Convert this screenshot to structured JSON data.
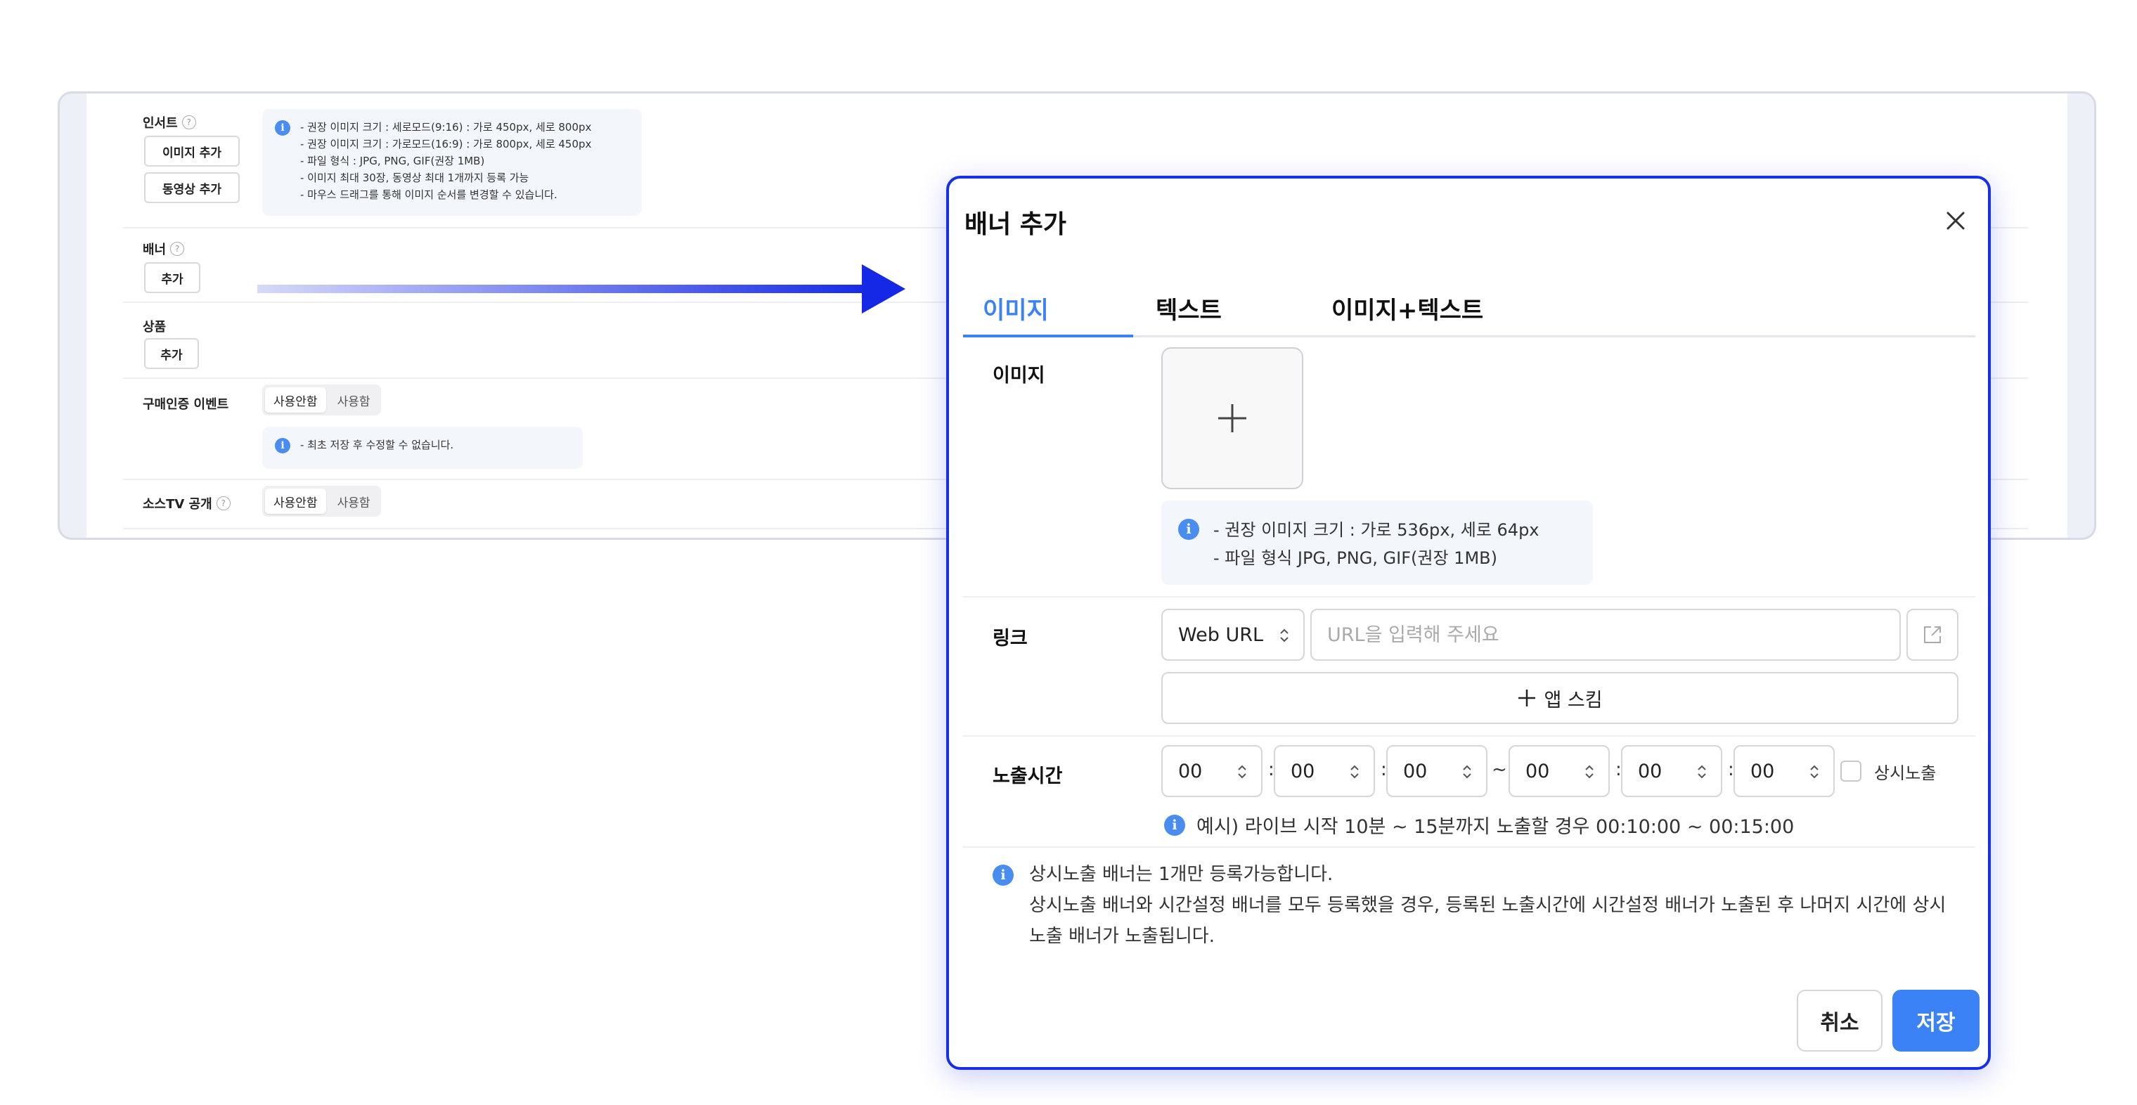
{
  "background_form": {
    "insert": {
      "label": "인서트",
      "add_image_button": "이미지 추가",
      "add_video_button": "동영상 추가",
      "info_lines": [
        "- 권장 이미지 크기 : 세로모드(9:16) : 가로 450px, 세로 800px",
        "- 권장 이미지 크기 : 가로모드(16:9) : 가로 800px, 세로 450px",
        "- 파일 형식 : JPG, PNG, GIF(권장 1MB)",
        "- 이미지 최대 30장, 동영상 최대 1개까지 등록 가능",
        "- 마우스 드래그를 통해 이미지 순서를 변경할 수 있습니다."
      ]
    },
    "banner": {
      "label": "배너",
      "add_button": "추가"
    },
    "product": {
      "label": "상품",
      "add_button": "추가"
    },
    "purchase_event": {
      "label": "구매인증 이벤트",
      "options": [
        "사용안함",
        "사용함"
      ],
      "selected": "사용안함",
      "info": "- 최초 저장 후 수정할 수 없습니다."
    },
    "sauce_tv": {
      "label": "소스TV 공개",
      "options": [
        "사용안함",
        "사용함"
      ],
      "selected": "사용안함"
    }
  },
  "modal": {
    "title": "배너 추가",
    "tabs": [
      {
        "label": "이미지",
        "active": true
      },
      {
        "label": "텍스트",
        "active": false
      },
      {
        "label": "이미지+텍스트",
        "active": false
      }
    ],
    "image": {
      "label": "이미지",
      "info_lines": [
        "- 권장 이미지 크기 : 가로 536px, 세로 64px",
        "- 파일 형식 JPG, PNG, GIF(권장 1MB)"
      ]
    },
    "link": {
      "label": "링크",
      "type_selected": "Web URL",
      "url_value": "",
      "url_placeholder": "URL을 입력해 주세요",
      "app_skim_button": "앱 스킴"
    },
    "display_time": {
      "label": "노출시간",
      "start": [
        "00",
        "00",
        "00"
      ],
      "end": [
        "00",
        "00",
        "00"
      ],
      "time_separator": ":",
      "range_separator": "~",
      "always_show_label": "상시노출",
      "always_show_checked": false,
      "example": "예시) 라이브 시작 10분 ~ 15분까지 노출할 경우 00:10:00 ~ 00:15:00"
    },
    "notice_lines": [
      "상시노출 배너는 1개만 등록가능합니다.",
      "상시노출 배너와 시간설정 배너를 모두 등록했을 경우, 등록된 노출시간에 시간설정 배너가 노출된 후 나머지 시간에 상시 노출 배너가 노출됩니다."
    ],
    "cancel_button": "취소",
    "save_button": "저장"
  },
  "colors": {
    "accent": "#3b82f6",
    "modal_border": "#1730e6",
    "arrow": "#1428e6",
    "info_bg": "#f3f6fb"
  }
}
